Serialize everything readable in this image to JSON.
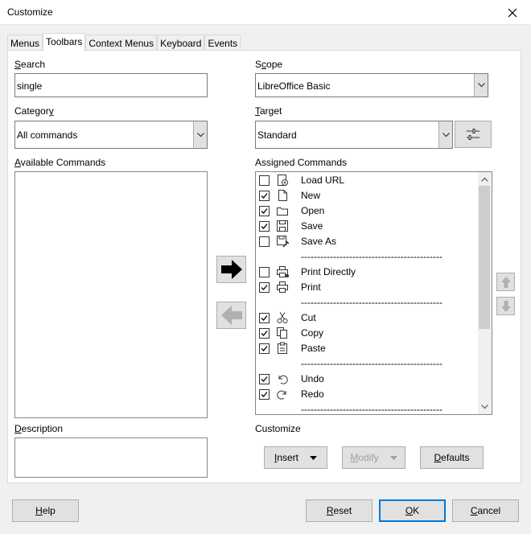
{
  "window": {
    "title": "Customize"
  },
  "tabs": [
    "Menus",
    "Toolbars",
    "Context Menus",
    "Keyboard",
    "Events"
  ],
  "search": {
    "label_u": "S",
    "label_rest": "earch",
    "value": "single"
  },
  "category": {
    "label_pre": "Categor",
    "label_u": "y",
    "value": "All commands"
  },
  "available": {
    "label_u": "A",
    "label_rest": "vailable Commands"
  },
  "description": {
    "label_u": "D",
    "label_rest": "escription"
  },
  "scope": {
    "label_pre": "S",
    "label_u": "c",
    "label_rest": "ope",
    "value": "LibreOffice Basic"
  },
  "target": {
    "label_u": "T",
    "label_rest": "arget",
    "value": "Standard"
  },
  "assigned": {
    "label": "Assigned Commands"
  },
  "separator_text": "--------------------------------------------",
  "commands": [
    {
      "label": "Load URL",
      "checked": false,
      "icon": "load-url-icon"
    },
    {
      "label": "New",
      "checked": true,
      "icon": "new-document-icon"
    },
    {
      "label": "Open",
      "checked": true,
      "icon": "folder-icon"
    },
    {
      "label": "Save",
      "checked": true,
      "icon": "save-icon"
    },
    {
      "label": "Save As",
      "checked": false,
      "icon": "save-as-icon"
    },
    {
      "separator": true
    },
    {
      "label": "Print Directly",
      "checked": false,
      "icon": "print-directly-icon"
    },
    {
      "label": "Print",
      "checked": true,
      "icon": "printer-icon"
    },
    {
      "separator": true
    },
    {
      "label": "Cut",
      "checked": true,
      "icon": "scissors-icon"
    },
    {
      "label": "Copy",
      "checked": true,
      "icon": "copy-icon"
    },
    {
      "label": "Paste",
      "checked": true,
      "icon": "clipboard-icon"
    },
    {
      "separator": true
    },
    {
      "label": "Undo",
      "checked": true,
      "icon": "undo-icon"
    },
    {
      "label": "Redo",
      "checked": true,
      "icon": "redo-icon"
    },
    {
      "separator": true
    }
  ],
  "customize": {
    "label": "Customize"
  },
  "buttons": {
    "insert_u": "I",
    "insert_rest": "nsert",
    "modify_u": "M",
    "modify_rest": "odify",
    "defaults_u": "D",
    "defaults_rest": "efaults",
    "help_u": "H",
    "help_rest": "elp",
    "reset_u": "R",
    "reset_rest": "eset",
    "ok_u": "O",
    "ok_rest": "K",
    "cancel_u": "C",
    "cancel_rest": "ancel"
  }
}
